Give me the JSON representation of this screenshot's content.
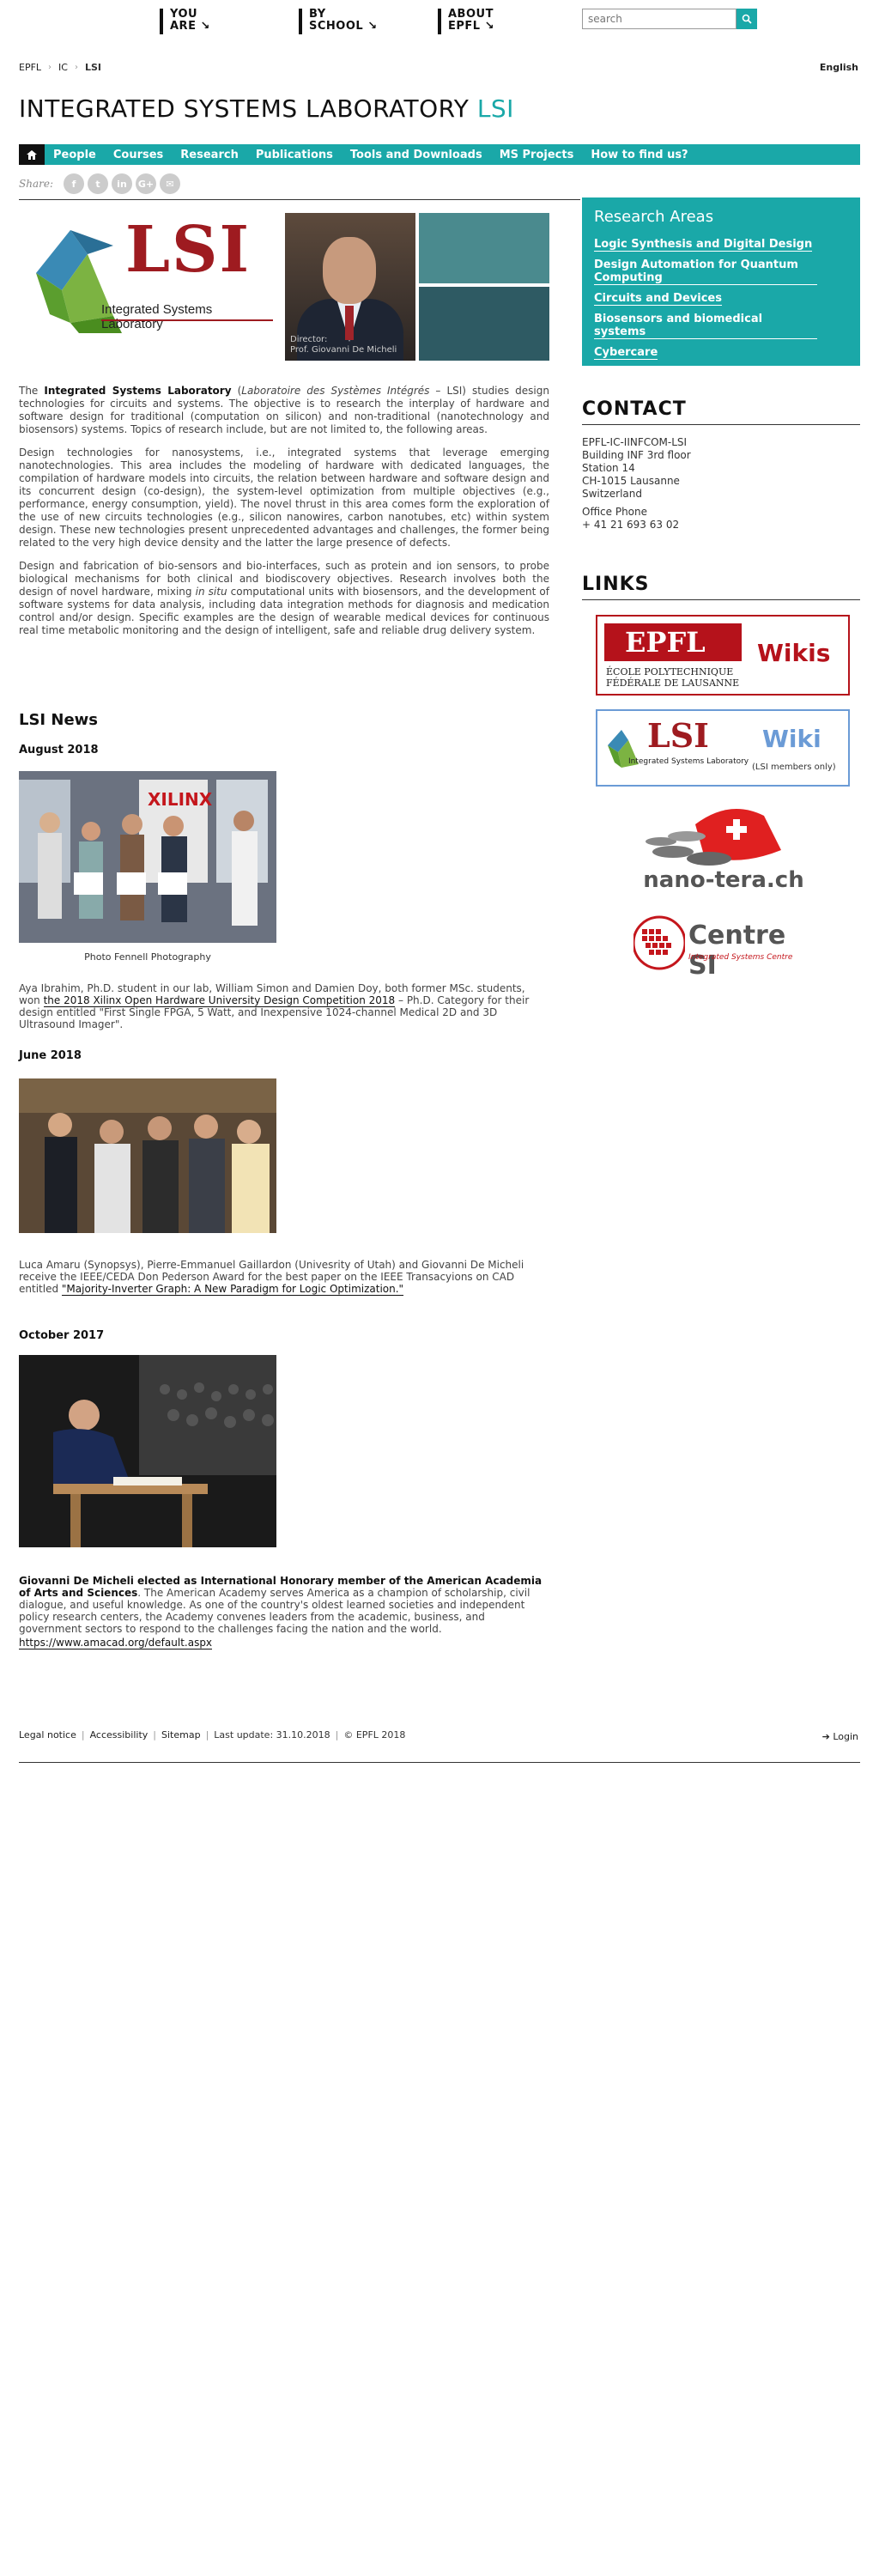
{
  "topnav": [
    {
      "line1": "YOU",
      "line2": "ARE"
    },
    {
      "line1": "BY",
      "line2": "SCHOOL"
    },
    {
      "line1": "ABOUT",
      "line2": "EPFL"
    }
  ],
  "search": {
    "placeholder": "search"
  },
  "breadcrumb": [
    "EPFL",
    "IC",
    "LSI"
  ],
  "language": "English",
  "site_title": {
    "main": "INTEGRATED SYSTEMS LABORATORY",
    "accent": "LSI"
  },
  "mainnav": [
    "People",
    "Courses",
    "Research",
    "Publications",
    "Tools and Downloads",
    "MS Projects",
    "How to find us?"
  ],
  "share": {
    "label": "Share:",
    "icons": [
      "f",
      "t",
      "in",
      "G+",
      "✉"
    ]
  },
  "hero": {
    "logo_text": "LSI",
    "logo_sub": "Integrated Systems Laboratory",
    "photo_caption_1": "Director:",
    "photo_caption_2": "Prof. Giovanni De Micheli"
  },
  "intro": {
    "p1_pre": "The ",
    "p1_bold": "Integrated Systems Laboratory",
    "p1_italic": "Laboratoire des Systèmes Intégrés",
    "p1_rest": " – LSI) studies design technologies for circuits and systems. The objective is to research the interplay of hardware and software design for traditional (computation on silicon) and non-traditional (nanotechnology and biosensors) systems. Topics of research include, but are not limited to, the following areas.",
    "p2": "Design technologies for nanosystems, i.e., integrated systems that leverage emerging nanotechnologies. This area includes the modeling of hardware with dedicated languages, the compilation of hardware models into circuits, the relation between hardware and software design and its concurrent design (co-design), the system-level optimization from multiple objectives (e.g., performance, energy consumption, yield). The novel thrust in this area comes form the exploration of the use of new circuits technologies (e.g., silicon nanowires, carbon nanotubes, etc) within system design. These new technologies present unprecedented advantages and challenges, the former being related to the very high device density and the latter the large presence of defects.",
    "p3_pre": "Design and fabrication of bio-sensors and bio-interfaces, such as protein and ion sensors, to probe biological mechanisms for both clinical and biodiscovery objectives. Research involves both the design of novel hardware, mixing ",
    "p3_italic": "in situ",
    "p3_rest": " computational units with biosensors, and the development of software systems for data analysis, including data integration methods for diagnosis and medication control and/or design. Specific examples are the design of wearable medical devices for continuous real time metabolic monitoring and the design of intelligent, safe and reliable drug delivery system."
  },
  "news": {
    "heading": "LSI News",
    "items": [
      {
        "month": "August 2018",
        "caption": "Photo Fennell Photography",
        "text_pre": "Aya Ibrahim, Ph.D. student in our lab, William Simon and Damien Doy, both former MSc. students, won ",
        "link": "the 2018 Xilinx Open Hardware University Design Competition 2018",
        "text_post": " – Ph.D. Category for their design entitled \"First Single FPGA, 5 Watt, and Inexpensive 1024-channel Medical 2D and 3D Ultrasound Imager\"."
      },
      {
        "month": "June 2018",
        "text_pre": "Luca Amaru (Synopsys), Pierre-Emmanuel Gaillardon (Univesrity of Utah) and Giovanni De Micheli receive the IEEE/CEDA Don Pederson Award for the best paper on the IEEE Transacyions on CAD entitled ",
        "link": "\"Majority-Inverter Graph: A New Paradigm for Logic Optimization.\""
      },
      {
        "month": "October 2017",
        "bold": "Giovanni De Micheli elected as International Honorary member of the American Academia of Arts and Sciences",
        "text": ". The American Academy serves America as a champion of scholarship, civil dialogue, and useful knowledge. As one of the country's oldest learned societies and independent policy research centers, the Academy convenes leaders from the academic, business, and government sectors to respond to the challenges facing the nation and the world.",
        "link": "https://www.amacad.org/default.aspx"
      }
    ]
  },
  "research_areas": {
    "title": "Research Areas",
    "items": [
      "Logic Synthesis and Digital Design",
      "Design Automation for Quantum Computing",
      "Circuits and Devices",
      "Biosensors and biomedical systems",
      "Cybercare"
    ]
  },
  "contact": {
    "title": "CONTACT",
    "lines": [
      "EPFL-IC-IINFCOM-LSI",
      "Building INF 3rd floor",
      "Station 14",
      "CH-1015 Lausanne",
      "Switzerland"
    ],
    "phone_label": "Office Phone",
    "phone": "+ 41 21 693 63 02"
  },
  "links": {
    "title": "LINKS",
    "epfl_wiki": {
      "epfl": "EPFL",
      "school_1": "ÉCOLE POLYTECHNIQUE",
      "school_2": "FÉDÉRALE DE LAUSANNE",
      "wikis": "Wikis"
    },
    "lsi_wiki": {
      "lsi": "LSI",
      "sub": "Integrated Systems Laboratory",
      "wiki": "Wiki",
      "note": "(LSI members only)"
    },
    "nanotera": "nano-tera.ch",
    "centresi": {
      "name": "Centre SI",
      "sub": "Integrated Systems Centre"
    }
  },
  "footer": {
    "items": [
      "Legal notice",
      "Accessibility",
      "Sitemap",
      "Last update: 31.10.2018",
      "© EPFL 2018"
    ],
    "login": "Login"
  },
  "colors": {
    "accent": "#1aa8a8",
    "dark": "#111111",
    "epfl_red": "#b5121b",
    "lsi_red": "#9e1b20"
  }
}
